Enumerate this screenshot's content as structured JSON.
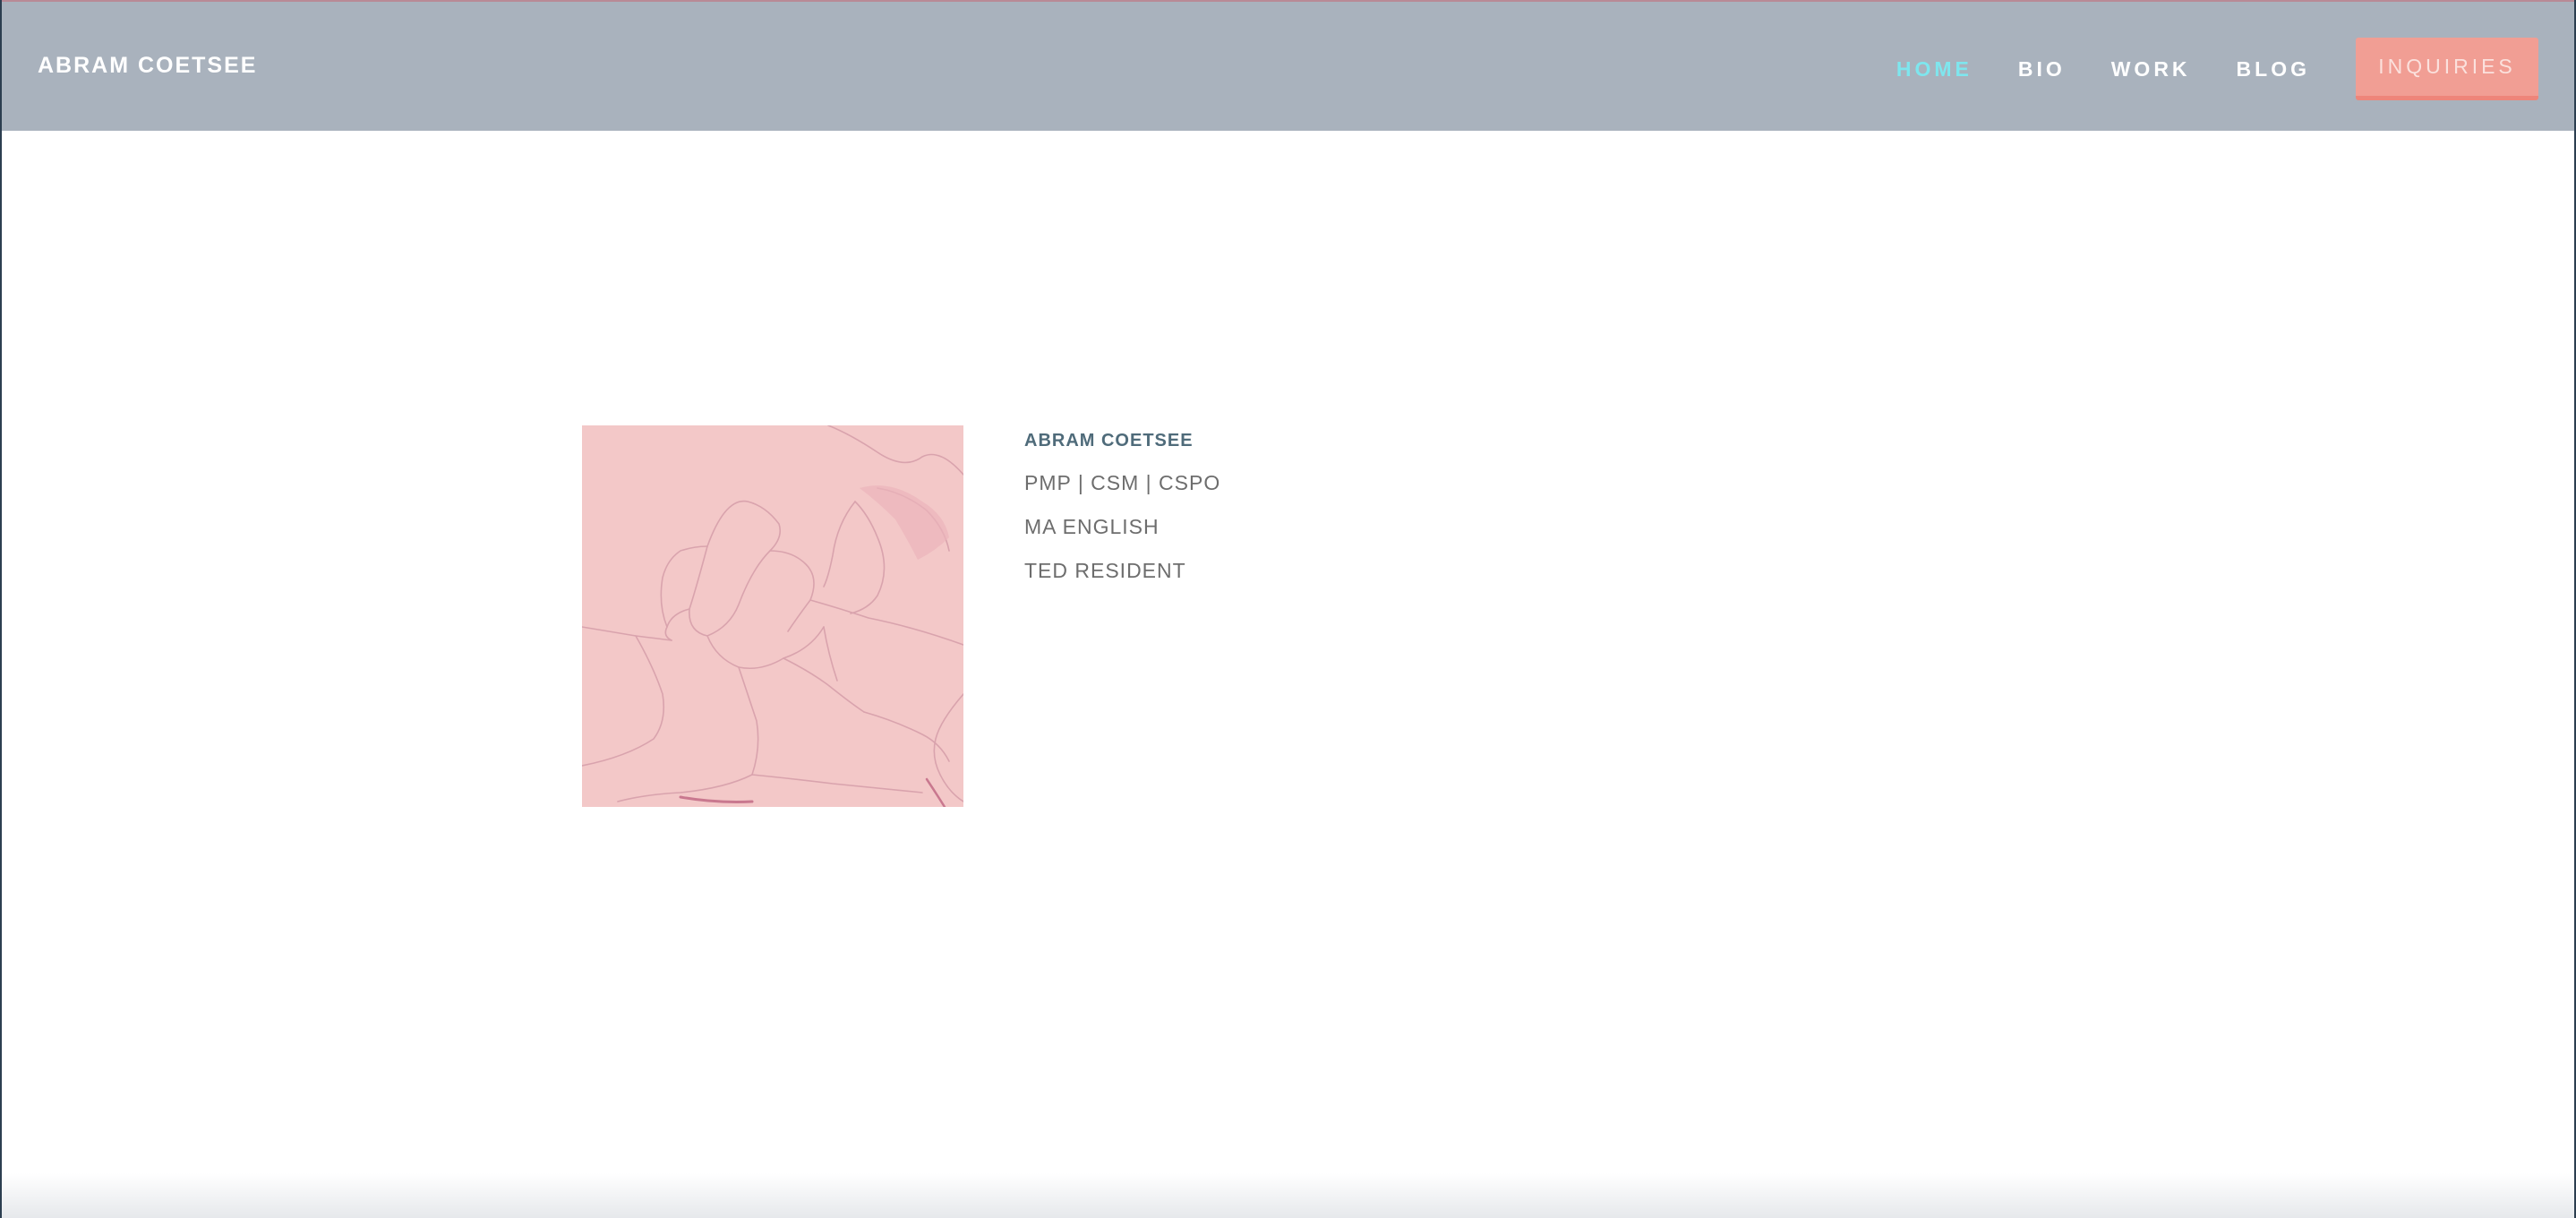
{
  "header": {
    "brand": "ABRAM COETSEE",
    "background_color": "#a9b2bd"
  },
  "nav": {
    "items": [
      {
        "label": "HOME",
        "active": true
      },
      {
        "label": "BIO",
        "active": false
      },
      {
        "label": "WORK",
        "active": false
      },
      {
        "label": "BLOG",
        "active": false
      }
    ],
    "active_color": "#7ee6ee",
    "cta_label": "INQUIRIES",
    "cta_color": "#f19e94"
  },
  "profile": {
    "photo_color": "#f3c8c8",
    "name": "ABRAM COETSEE",
    "lines": [
      "PMP | CSM | CSPO",
      "MA ENGLISH",
      "TED RESIDENT"
    ]
  }
}
